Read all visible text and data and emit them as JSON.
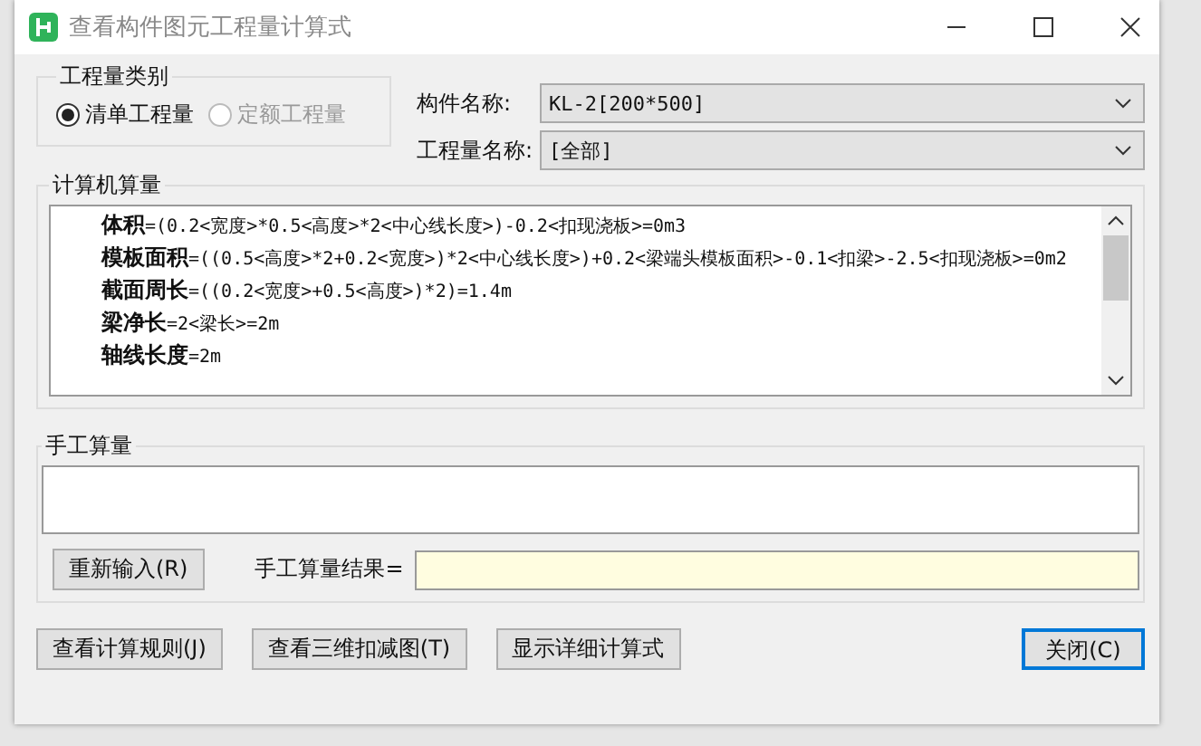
{
  "window": {
    "title": "查看构件图元工程量计算式"
  },
  "quantity_type": {
    "legend": "工程量类别",
    "options": [
      {
        "label": "清单工程量",
        "selected": true,
        "disabled": false
      },
      {
        "label": "定额工程量",
        "selected": false,
        "disabled": true
      }
    ]
  },
  "fields": [
    {
      "label": "构件名称:",
      "value": "KL-2[200*500]"
    },
    {
      "label": "工程量名称:",
      "value": "[全部]"
    }
  ],
  "computed": {
    "legend": "计算机算量",
    "lines": [
      "**体积**=(0.2<宽度>*0.5<高度>*2<中心线长度>)-0.2<扣现浇板>=0m3",
      "**模板面积**=((0.5<高度>*2+0.2<宽度>)*2<中心线长度>)+0.2<梁端头模板面积>-0.1<扣梁>-2.5<扣现浇板>=0m2",
      "**截面周长**=((0.2<宽度>+0.5<高度>)*2)=1.4m",
      "**梁净长**=2<梁长>=2m",
      "**轴线长度**=2m"
    ]
  },
  "manual": {
    "legend": "手工算量",
    "reinput_button": "重新输入(R)",
    "result_label": "手工算量结果="
  },
  "buttons": [
    {
      "label": "查看计算规则(J)",
      "focused": false
    },
    {
      "label": "查看三维扣减图(T)",
      "focused": false
    },
    {
      "label": "显示详细计算式",
      "focused": false
    },
    {
      "label": "关闭(C)",
      "focused": true
    }
  ]
}
